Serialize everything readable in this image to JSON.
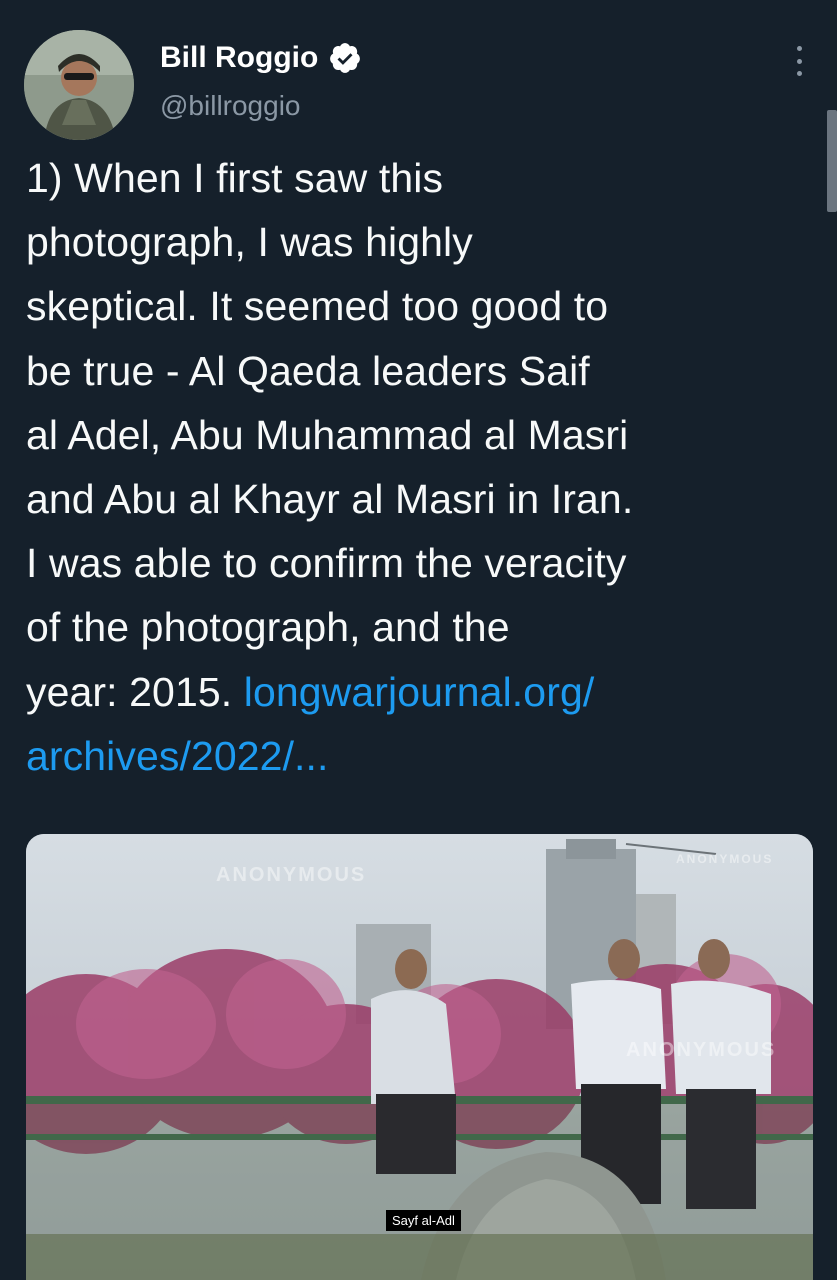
{
  "author": {
    "name": "Bill Roggio",
    "handle": "@billroggio",
    "verified": true
  },
  "tweet": {
    "text": "1) When I first saw this\nphotograph, I was highly\nskeptical. It seemed too good to\nbe true - Al Qaeda leaders Saif\nal Adel, Abu Muhammad al Masri\nand Abu al Khayr al Masri in Iran.\nI was able to confirm the veracity\nof the photograph, and the\nyear: 2015. ",
    "link_text": "longwarjournal.org/\narchives/2022/..."
  },
  "media": {
    "caption": "Sayf al-Adl",
    "watermark_top": "ANONYMOUS",
    "watermark_mid": "ANONYMOUS",
    "watermark_bottom": "ANONYMOUS"
  },
  "colors": {
    "background": "#15202b",
    "link": "#1d9bf0",
    "secondary_text": "#8b98a5",
    "verified_badge": "#ffffff"
  },
  "icons": {
    "more": "more-vertical-icon",
    "verified": "verified-badge-icon"
  }
}
